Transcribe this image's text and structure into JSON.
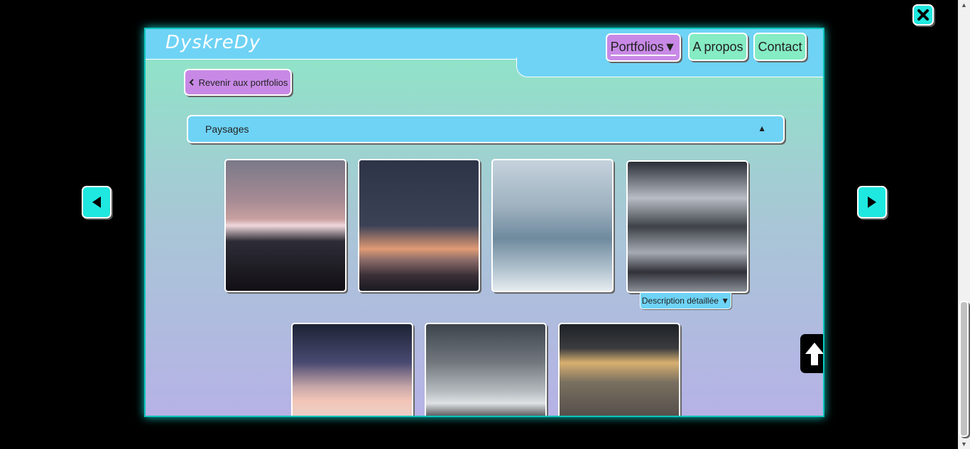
{
  "window": {
    "close_icon": "close-icon"
  },
  "header": {
    "logo_text": "DyskreDy",
    "nav": {
      "portfolios": "Portfolios",
      "portfolios_caret": "▼",
      "apropos": "A propos",
      "contact": "Contact"
    }
  },
  "back_button": {
    "label": "Revenir aux portfolios",
    "icon": "chevron-left-icon"
  },
  "accordion": {
    "title": "Paysages",
    "caret": "▲"
  },
  "gallery": {
    "images": [
      {
        "name": "photo-pink-mountains"
      },
      {
        "name": "photo-sunset-hills"
      },
      {
        "name": "photo-foggy-forest"
      },
      {
        "name": "photo-fog-valley"
      },
      {
        "name": "photo-pink-clouds"
      },
      {
        "name": "photo-sun-in-fog"
      },
      {
        "name": "photo-sunrays-clouds"
      }
    ],
    "description_toggle": "Description détaillée ▼"
  },
  "nav_arrows": {
    "prev_icon": "prev-arrow-icon",
    "next_icon": "next-arrow-icon",
    "scroll_top_icon": "scroll-top-icon"
  }
}
